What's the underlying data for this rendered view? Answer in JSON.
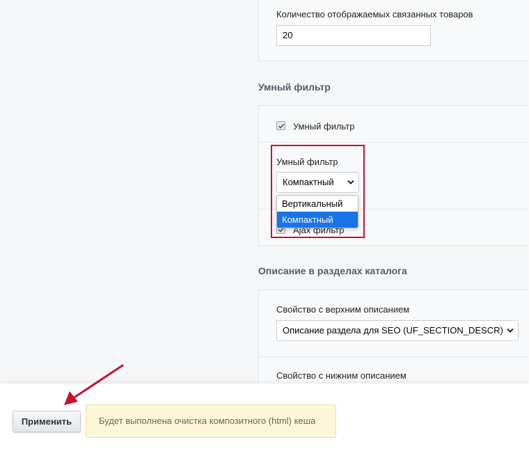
{
  "related": {
    "label": "Количество отображаемых связанных товаров",
    "value": "20"
  },
  "smart_filter_section": {
    "title": "Умный фильтр",
    "checkbox_label": "Умный фильтр",
    "select_label": "Умный фильтр",
    "select_value": "Компактный",
    "options": [
      "Вертикальный",
      "Компактный"
    ],
    "ajax_label": "Ajax фильтр"
  },
  "catalog_desc_section": {
    "title": "Описание в разделах каталога",
    "top_label": "Свойство с верхним описанием",
    "top_value": "Описание раздела для SEO (UF_SECTION_DESCR)",
    "bottom_label": "Свойство с нижним описанием"
  },
  "footer": {
    "apply_label": "Применить",
    "notice": "Будет выполнена очистка композитного (html) кеша"
  },
  "colors": {
    "highlight": "#c8102e",
    "selected_option": "#1a73e8",
    "notice_bg": "#fdf7d9"
  },
  "icons": [
    "checkmark-icon",
    "chevron-down-icon",
    "annotation-arrow"
  ]
}
